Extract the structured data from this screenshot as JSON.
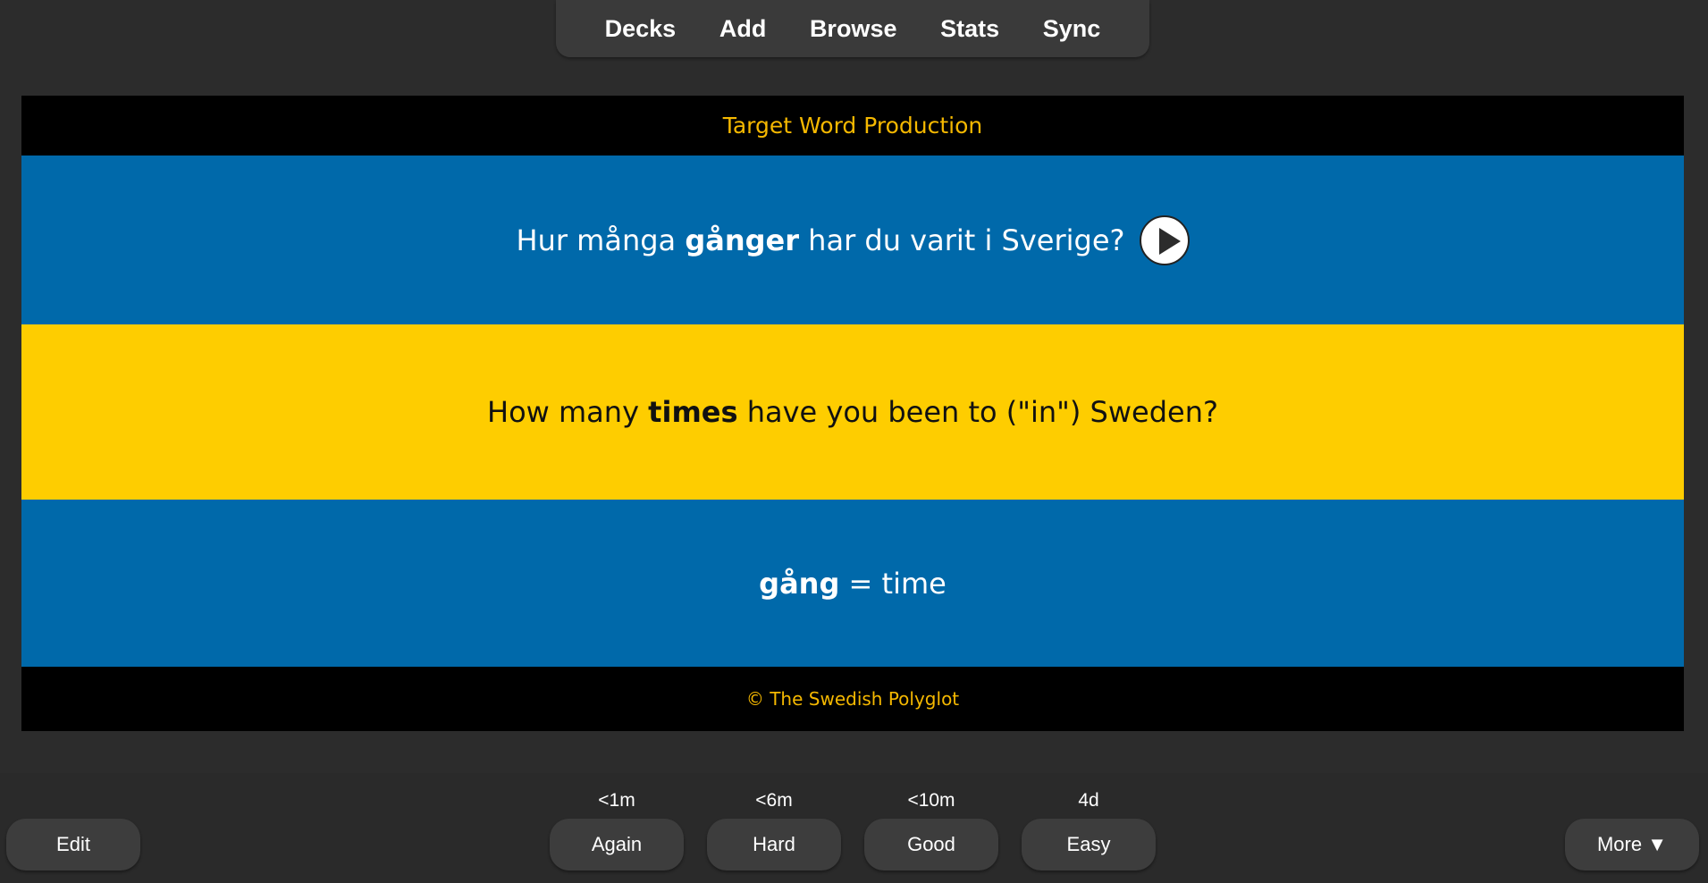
{
  "nav": {
    "items": [
      "Decks",
      "Add",
      "Browse",
      "Stats",
      "Sync"
    ]
  },
  "card": {
    "header": "Target Word Production",
    "front": {
      "before": "Hur många ",
      "bold": "gånger",
      "after": " har du varit i Sverige?"
    },
    "translation": {
      "before": "How many ",
      "bold": "times",
      "after": " have you been to (\"in\") Sweden?"
    },
    "answer": {
      "bold": "gång",
      "after": " = time"
    },
    "footer": "© The Swedish Polyglot",
    "colors": {
      "blue": "#0069aa",
      "yellow": "#fecd00",
      "header_text": "#f5b800"
    }
  },
  "bottom": {
    "edit_label": "Edit",
    "more_label": "More ▼",
    "answers": [
      {
        "label": "Again",
        "interval": "<1m"
      },
      {
        "label": "Hard",
        "interval": "<6m"
      },
      {
        "label": "Good",
        "interval": "<10m"
      },
      {
        "label": "Easy",
        "interval": "4d"
      }
    ]
  }
}
